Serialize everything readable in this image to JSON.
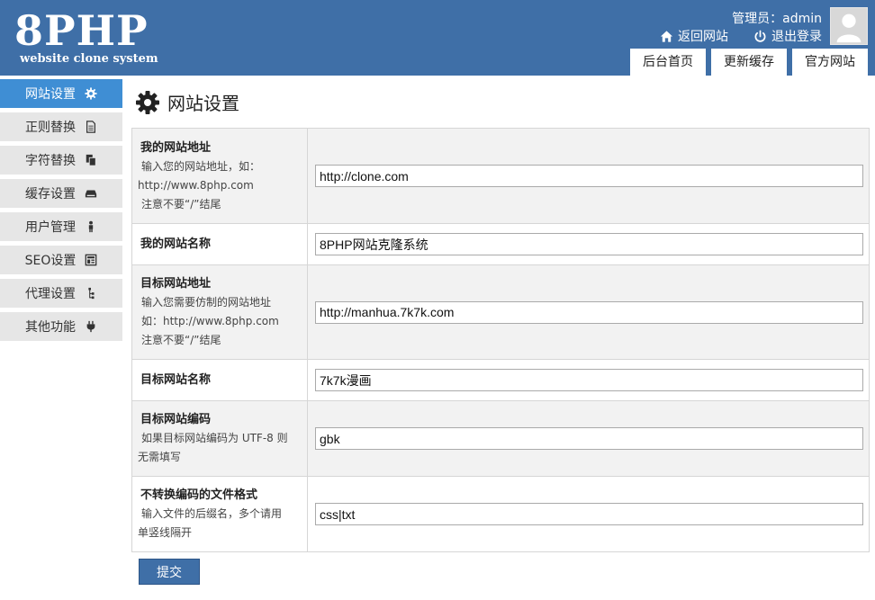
{
  "header": {
    "logo_text": "8PHP",
    "logo_subtitle": "website clone system",
    "admin_label": "管理员：",
    "admin_name": "admin",
    "back_to_site": "返回网站",
    "logout": "退出登录",
    "tabs": [
      "后台首页",
      "更新缓存",
      "官方网站"
    ]
  },
  "sidebar": {
    "items": [
      {
        "label": "网站设置",
        "icon": "gear-icon",
        "active": true
      },
      {
        "label": "正则替换",
        "icon": "document-icon"
      },
      {
        "label": "字符替换",
        "icon": "copy-icon"
      },
      {
        "label": "缓存设置",
        "icon": "hdd-icon"
      },
      {
        "label": "用户管理",
        "icon": "user-icon"
      },
      {
        "label": "SEO设置",
        "icon": "layout-icon"
      },
      {
        "label": "代理设置",
        "icon": "sitemap-icon"
      },
      {
        "label": "其他功能",
        "icon": "plug-icon"
      }
    ]
  },
  "main": {
    "title": "网站设置",
    "rows": [
      {
        "title": "我的网站地址",
        "desc": [
          "输入您的网站地址，如：",
          "http://www.8php.com",
          "注意不要“/”结尾"
        ],
        "value": "http://clone.com"
      },
      {
        "title": "我的网站名称",
        "desc": [],
        "value": "8PHP网站克隆系统"
      },
      {
        "title": "目标网站地址",
        "desc": [
          "输入您需要仿制的网站地址",
          "如：http://www.8php.com",
          "注意不要“/”结尾"
        ],
        "value": "http://manhua.7k7k.com"
      },
      {
        "title": "目标网站名称",
        "desc": [],
        "value": "7k7k漫画"
      },
      {
        "title": "目标网站编码",
        "desc": [
          "如果目标网站编码为 UTF-8 则",
          "无需填写"
        ],
        "value": "gbk"
      },
      {
        "title": "不转换编码的文件格式",
        "desc": [
          "输入文件的后缀名，多个请用",
          "单竖线隔开"
        ],
        "value": "css|txt"
      }
    ],
    "submit_label": "提交"
  },
  "colors": {
    "header_bg": "#3f6fa7",
    "active_sidebar": "#3f8ed4",
    "row_shade": "#f2f2f2"
  }
}
